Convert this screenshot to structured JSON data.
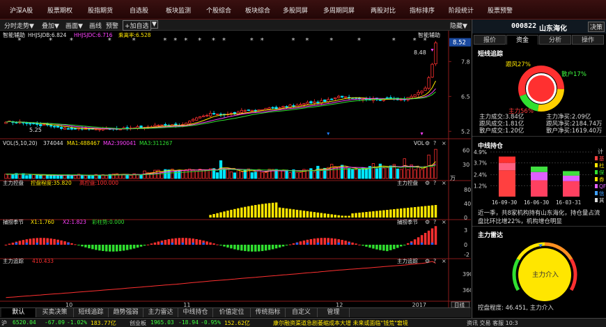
{
  "topnav": [
    "沪深A股",
    "股票期权",
    "股指期货",
    "自选股",
    "板块监测",
    "个股综合",
    "板块综合",
    "多股同屏",
    "多周期同屏",
    "两股对比",
    "指标排序",
    "阶段统计",
    "股票预警"
  ],
  "toolbar": {
    "items": [
      "分时走势",
      "叠加",
      "画面",
      "画线",
      "预警",
      "+加自选",
      "隐藏"
    ],
    "arrow": "▼"
  },
  "main_panel": {
    "label_left": "智能辅助",
    "label_right": "智能辅助",
    "ind1_name": "HHJSJDB:6.824",
    "ind2_name": "HHJSJDC:6.716",
    "ind3_name": "乘离率:6.528",
    "price_now": "8.52",
    "price_high_label": "8.48",
    "price_low_label": "5.25",
    "y_ticks": [
      "7.8",
      "6.5",
      "5.2"
    ],
    "star_glyph": "*"
  },
  "vol_panel": {
    "label": "VOL(5,10,20)",
    "vol_val": "374044",
    "ma1": "MA1:488467",
    "ma2": "MA2:390041",
    "ma3": "MA3:311267",
    "label_right": "VOL",
    "y_ticks": [
      "60",
      "30",
      "万"
    ]
  },
  "zlkp_panel": {
    "label": "主力控盘",
    "val1": "控盘程度:35.820",
    "val2": "高控盘:100.000",
    "label_right": "主力控盘",
    "y_ticks": [
      "80",
      "40",
      "0"
    ]
  },
  "bzjj_panel": {
    "label": "捕捞季节",
    "x1": "X1:1.760",
    "x2": "X2:1.823",
    "cz": "彩柱势:0.000",
    "label_right": "捕捞季节",
    "y_ticks": [
      "3",
      "0",
      "-2"
    ]
  },
  "zlzz_panel": {
    "label": "主力追踪",
    "val": "410.433",
    "label_right": "主力追踪",
    "y_ticks": [
      "390",
      "360"
    ]
  },
  "x_axis": {
    "ticks": [
      "10",
      "11",
      "12",
      "2017"
    ],
    "period": "日线"
  },
  "bottom_tabs": [
    "默认",
    "买卖决策",
    "短线追踪",
    "趋势强弱",
    "主力雷达",
    "中线持仓",
    "价值定位",
    "传统指标",
    "自定义",
    "管理"
  ],
  "status": {
    "sh_name": "沪",
    "sh_val": "6520.04",
    "sh_chg": "-67.09",
    "sh_pct": "-1.02%",
    "sh_amt": "183.77亿",
    "cy_name": "创业板",
    "cy_val": "1965.03",
    "cy_chg": "-18.94",
    "cy_pct": "-0.95%",
    "cy_amt": "152.62亿",
    "news": "康尔融资渠道急剧萎缩成本大增 未来或面临\"钱荒\"窘境",
    "right": "资讯   交易   客服  10:3"
  },
  "right_panel": {
    "code": "000822",
    "name": "山东海化",
    "decision_btn": "决策",
    "tabs": [
      "报价",
      "资金",
      "分析",
      "操作"
    ],
    "short_title": "短线追踪",
    "donut": {
      "follow_label": "跟风27%",
      "retail_label": "散户17%",
      "main_label": "主力56%",
      "segments": [
        {
          "name": "主力",
          "pct": 56,
          "color": "#ff3030"
        },
        {
          "name": "跟风",
          "pct": 27,
          "color": "#ffd000"
        },
        {
          "name": "散户",
          "pct": 17,
          "color": "#30e030"
        }
      ]
    },
    "flow_rows": [
      [
        "主力成交:3.84亿",
        "主力净买:2.09亿"
      ],
      [
        "跟风成交:1.81亿",
        "跟风净买:2184.74万"
      ],
      [
        "散户成交:1.20亿",
        "散户净买:1619.40万"
      ]
    ],
    "mid_title": "中线持仓",
    "mid_chart": {
      "y_ticks": [
        "4.9%",
        "3.7%",
        "2.4%",
        "1.2%"
      ],
      "x_labels": [
        "16-09-30",
        "16-06-30",
        "16-03-31"
      ],
      "bars": [
        {
          "date": "16-09-30",
          "total": 4.4,
          "parts": [
            {
              "v": 2.9,
              "color": "#ff4040"
            },
            {
              "v": 0.8,
              "color": "#ff6080"
            },
            {
              "v": 0.7,
              "color": "#ff3030"
            }
          ]
        },
        {
          "date": "16-06-30",
          "total": 3.3,
          "parts": [
            {
              "v": 1.8,
              "color": "#ff4060"
            },
            {
              "v": 0.9,
              "color": "#e060ff"
            },
            {
              "v": 0.6,
              "color": "#40e040"
            }
          ]
        },
        {
          "date": "16-03-31",
          "total": 2.8,
          "parts": [
            {
              "v": 1.7,
              "color": "#ff4060"
            },
            {
              "v": 0.6,
              "color": "#e060ff"
            },
            {
              "v": 0.5,
              "color": "#40e040"
            }
          ]
        }
      ],
      "legend": [
        "基",
        "社",
        "保",
        "券",
        "QF",
        "信",
        "其"
      ],
      "legend_head": "计"
    },
    "mid_note": [
      "近一季，共8家机构持有山东海化，持仓量占流",
      "盘比环比增22%，机构增仓明显"
    ],
    "radar_title": "主力雷达",
    "gauge_label": "主力介入",
    "gauge_level": 46.451,
    "radar_footer": "控盘程度: 46.451, 主力介入"
  },
  "chart_data": [
    {
      "type": "candlestick",
      "title": "智能辅助",
      "ylim": [
        5.0,
        8.9
      ],
      "y_ticks": [
        7.8,
        6.5,
        5.2
      ],
      "series_names": [
        "HHJSJDB",
        "HHJSJDC",
        "乘离率"
      ],
      "last_values": [
        6.824,
        6.716,
        6.528
      ],
      "last_price": 8.52,
      "high_label": 8.48,
      "low_label": 5.25
    },
    {
      "type": "bar",
      "title": "VOL(5,10,20)",
      "y_ticks": [
        60,
        30
      ],
      "unit": "万",
      "last_values": {
        "VOL": 374044,
        "MA1": 488467,
        "MA2": 390041,
        "MA3": 311267
      }
    },
    {
      "type": "bar",
      "title": "主力控盘",
      "ylim": [
        0,
        100
      ],
      "y_ticks": [
        80,
        40,
        0
      ],
      "last_values": {
        "控盘程度": 35.82,
        "高控盘": 100.0
      }
    },
    {
      "type": "bar",
      "title": "捕捞季节",
      "y_ticks": [
        3,
        0,
        -2
      ],
      "last_values": {
        "X1": 1.76,
        "X2": 1.823,
        "彩柱势": 0.0
      }
    },
    {
      "type": "line",
      "title": "主力追踪",
      "y_ticks": [
        390,
        360
      ],
      "last_values": {
        "主力追踪": 410.433
      }
    }
  ]
}
